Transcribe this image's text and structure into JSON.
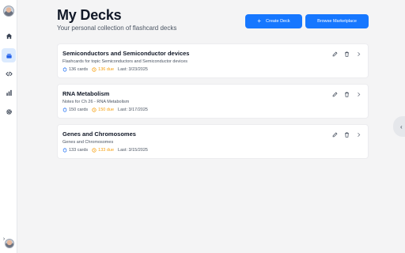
{
  "header": {
    "title": "My Decks",
    "subtitle": "Your personal collection of flashcard decks",
    "create_label": "Create Deck",
    "marketplace_label": "Browse Marketplace"
  },
  "decks": [
    {
      "title": "Semiconductors and Semiconductor devices",
      "description": "Flashcards for topic Semiconductors and Semiconductor devices",
      "cards": "136 cards",
      "due": "136 due",
      "last": "Last: 3/23/2025"
    },
    {
      "title": "RNA Metabolism",
      "description": "Notes for Ch 26 - RNA Metabolism",
      "cards": "150 cards",
      "due": "150 due",
      "last": "Last: 3/17/2025"
    },
    {
      "title": "Genes and Chromosomes",
      "description": "Genes and Chromosomes",
      "cards": "133 cards",
      "due": "133 due",
      "last": "Last: 3/15/2025"
    }
  ],
  "sidebar": {
    "items": [
      {
        "icon": "home-icon"
      },
      {
        "icon": "cards-icon",
        "active": true
      },
      {
        "icon": "code-icon"
      },
      {
        "icon": "bar-chart-icon"
      },
      {
        "icon": "gear-icon"
      }
    ]
  },
  "colors": {
    "accent": "#1677ff",
    "due": "#f59e0b",
    "background": "#f4f4f5"
  }
}
